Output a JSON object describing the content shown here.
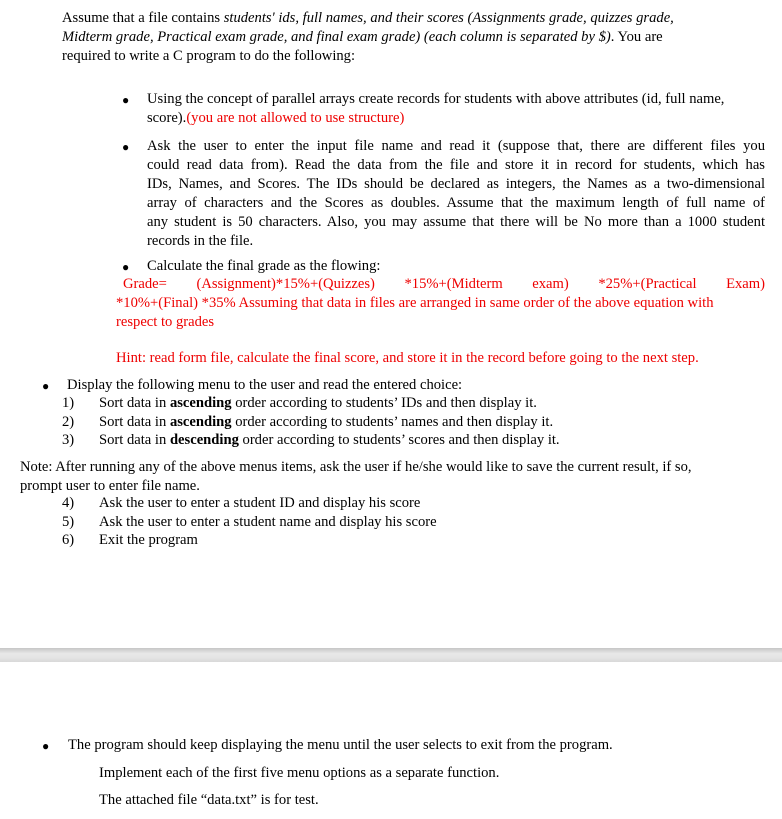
{
  "intro": {
    "line1_a": "Assume that a file contains ",
    "line1_b": "students' ids, full names, and their scores (Assignments grade, quizzes grade,",
    "line2_a": "Midterm grade, Practical exam grade, and final exam grade) (each column is separated by $)",
    "line2_b": ". You are",
    "line3": "required to write a C program to do the following:"
  },
  "bullets": {
    "b1_line1": "Using the concept of parallel arrays create records for students with above attributes (id, full name,",
    "b1_line2_a": "score).",
    "b1_line2_b": "(you are not allowed to use structure)",
    "b2_lines": [
      "Ask the user to enter the input file name and read it (suppose that, there are different files you",
      "could read data from). Read the data from the file and store it in record for students, which has",
      "IDs, Names, and Scores. The IDs should be declared as integers, the Names as a two-dimensional",
      "array of characters and the Scores as doubles. Assume that the maximum length of full name of",
      "any student is 50 characters.  Also, you may assume that there will be No more than a 1000 student",
      "records in the file."
    ],
    "b3_line1": "Calculate the final grade as the flowing:",
    "b3_formula_line1": "Grade=    (Assignment)*15%+(Quizzes)    *15%+(Midterm    exam)    *25%+(Practical    Exam)",
    "b3_formula_line2": "*10%+(Final) *35% Assuming that data in files are arranged in same order of the above equation with",
    "b3_formula_line3": "respect to grades",
    "hint": "Hint: read form file, calculate the final score, and store it in the record before going to the next step."
  },
  "menu": {
    "intro": "Display the following menu to the user and read the entered choice:",
    "items": [
      {
        "num": "1)",
        "pre": "Sort data in ",
        "bold": "ascending",
        "post": " order according to students’ IDs and then display it."
      },
      {
        "num": "2)",
        "pre": "Sort data in ",
        "bold": "ascending",
        "post": " order according to students’ names and then display it."
      },
      {
        "num": "3)",
        "pre": "Sort data in ",
        "bold": "descending",
        "post": " order according to students’ scores and then display it."
      }
    ],
    "note_line1": "Note: After running any of the above menus items, ask the user if he/she would like to save the current result, if so,",
    "note_line2": "prompt user to enter file name.",
    "items2": [
      {
        "num": "4)",
        "text": "Ask the user to enter a student ID and display his score"
      },
      {
        "num": "5)",
        "text": "Ask the user to enter a student name and display his score"
      },
      {
        "num": "6)",
        "text": "Exit the program"
      }
    ]
  },
  "page2": {
    "bullet": "The program should keep displaying the menu until the user selects to exit from the program.",
    "line2": "Implement each of the first five menu options as a separate function.",
    "line3": "The attached file “data.txt” is for test."
  },
  "colors": {
    "red_text": "#ee0000",
    "separator": "#d9d9d9"
  }
}
